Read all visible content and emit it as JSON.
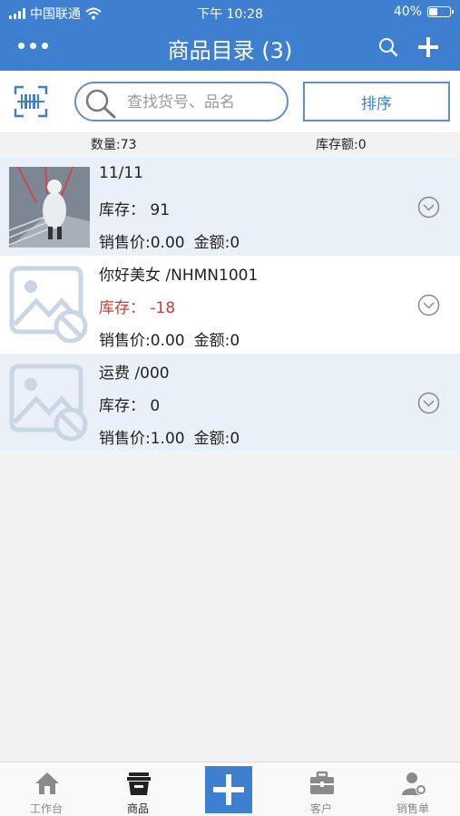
{
  "status": {
    "carrier": "中国联通",
    "time": "下午 10:28",
    "battery": "40%"
  },
  "nav": {
    "title": "商品目录 (3)"
  },
  "search": {
    "placeholder": "查找货号、品名",
    "sort_label": "排序"
  },
  "summary": {
    "count": "数量:73",
    "stock_amount": "库存额:0"
  },
  "products": [
    {
      "name": "11/11",
      "stock": "库存：  91",
      "price": "销售价:0.00",
      "amount": "金额:0",
      "image": "photo",
      "negative": false
    },
    {
      "name": "你好美女 /NHMN1001",
      "stock": "库存：  -18",
      "price": "销售价:0.00",
      "amount": "金额:0",
      "image": "placeholder",
      "negative": true
    },
    {
      "name": "运费 /000",
      "stock": "库存：  0",
      "price": "销售价:1.00",
      "amount": "金额:0",
      "image": "placeholder",
      "negative": false
    }
  ],
  "tabs": [
    {
      "label": "工作台",
      "icon": "home-icon"
    },
    {
      "label": "商品",
      "icon": "basket-icon"
    },
    {
      "label": "",
      "icon": "plus-icon"
    },
    {
      "label": "客户",
      "icon": "briefcase-icon"
    },
    {
      "label": "销售单",
      "icon": "person-gear-icon"
    }
  ],
  "colors": {
    "primary": "#3f7fd0",
    "negative": "#d03a2c",
    "row_alt": "#e9f0f7",
    "placeholder_icon": "#c9d6e3"
  }
}
